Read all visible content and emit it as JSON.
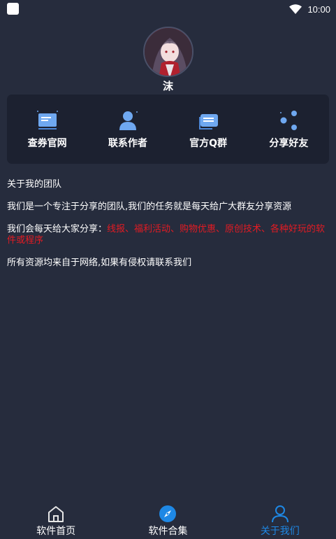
{
  "status_bar": {
    "time": "10:00"
  },
  "profile": {
    "name": "沫"
  },
  "actions": [
    {
      "label": "查券官网",
      "icon": "message-card-icon"
    },
    {
      "label": "联系作者",
      "icon": "user-icon"
    },
    {
      "label": "官方Q群",
      "icon": "chat-bubble-icon"
    },
    {
      "label": "分享好友",
      "icon": "share-icon"
    }
  ],
  "about": {
    "title": "关于我的团队",
    "p1": "我们是一个专注于分享的团队,我们的任务就是每天给广大群友分享资源",
    "p2_lead": "我们会每天给大家分享：",
    "p2_highlight": "线报、福利活动、购物优惠、原创技术、各种好玩的软件或程序",
    "p3": "所有资源均来自于网络,如果有侵权请联系我们"
  },
  "bottom_nav": [
    {
      "label": "软件首页",
      "icon": "home-icon",
      "active": false
    },
    {
      "label": "软件合集",
      "icon": "compass-icon",
      "active": false
    },
    {
      "label": "关于我们",
      "icon": "user-outline-icon",
      "active": true
    }
  ],
  "colors": {
    "background": "#262c3d",
    "card": "#1c2130",
    "accent": "#1e88e5",
    "highlight_red": "#e31b23"
  }
}
